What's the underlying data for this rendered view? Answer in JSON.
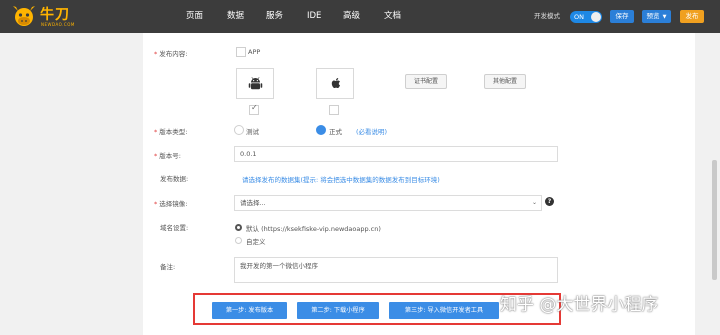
{
  "topbar": {
    "logo_text": "牛刀",
    "logo_sub": "NEWDAO.COM",
    "nav": [
      "页面",
      "数据",
      "服务",
      "IDE",
      "高级",
      "文档"
    ],
    "dev_mode_label": "开发模式",
    "toggle_label": "ON",
    "save_label": "保存",
    "preview_label": "预览",
    "publish_label": "发布"
  },
  "form": {
    "content_label": "发布内容:",
    "app_option": "APP",
    "platforms": [
      "android-icon",
      "apple-icon"
    ],
    "cert_button": "证书配置",
    "other_button": "其他配置",
    "version_type_label": "版本类型:",
    "version_type_test": "测试",
    "version_type_official": "正式",
    "version_type_note": "(必看说明)",
    "version_no_label": "版本号:",
    "version_no_value": "0.0.1",
    "data_label": "发布数据:",
    "data_hint": "请选择发布的数据集(提示: 将会把选中数据集的数据发布到目标环境)",
    "image_label": "选择镜像:",
    "image_placeholder": "请选择...",
    "domain_label": "域名设置:",
    "domain_default": "默认 (https://ksekfiske-vip.newdaoapp.cn)",
    "domain_custom": "自定义",
    "note_label": "备注:",
    "note_value": "我开发的第一个微信小程序"
  },
  "steps": [
    "第一步: 发布版本",
    "第二步: 下载小程序",
    "第三步: 导入微信开发者工具"
  ],
  "watermark": "知乎 @大世界小程序",
  "colors": {
    "topbar": "#3c3c3c",
    "accent": "#3b8de6",
    "brand": "#ffb400",
    "publish": "#f0a020",
    "highlight_box": "#e53935"
  }
}
